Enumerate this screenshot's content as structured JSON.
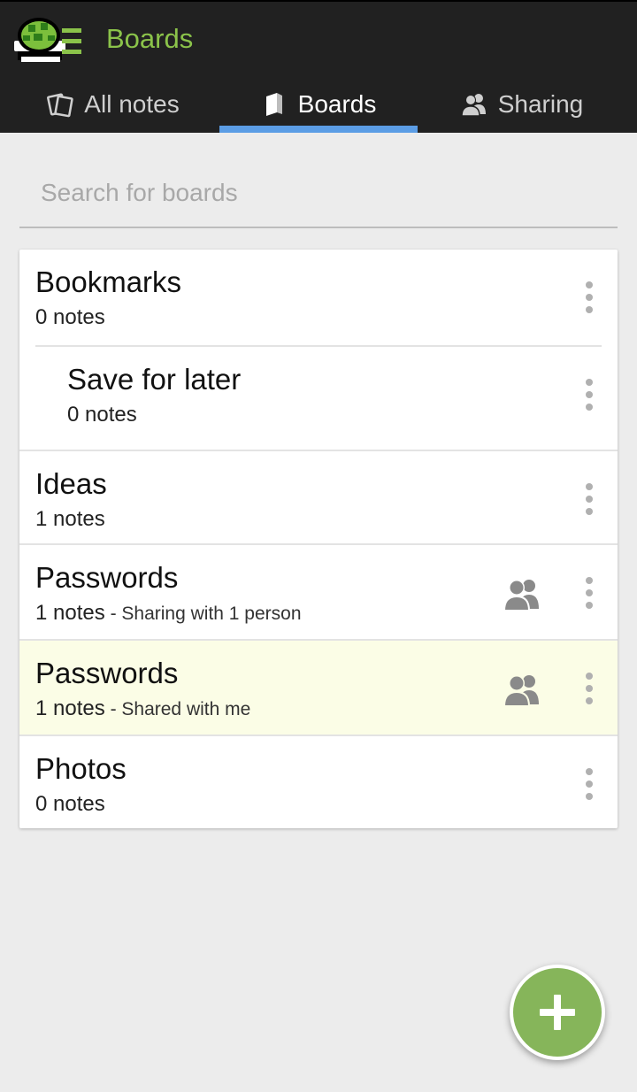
{
  "app": {
    "title": "Boards",
    "accent_color": "#8bc34a",
    "logo_icon": "turtle-shell-logo"
  },
  "tabs": [
    {
      "label": "All notes",
      "icon": "notes-icon",
      "active": false
    },
    {
      "label": "Boards",
      "icon": "board-book-icon",
      "active": true
    },
    {
      "label": "Sharing",
      "icon": "people-icon",
      "active": false
    }
  ],
  "search": {
    "placeholder": "Search for boards",
    "value": ""
  },
  "boards": [
    {
      "name": "Bookmarks",
      "count": "0 notes",
      "extra": ""
    },
    {
      "name": "Save for later",
      "count": "0 notes",
      "extra": "",
      "nested": true
    },
    {
      "name": "Ideas",
      "count": "1 notes",
      "extra": ""
    },
    {
      "name": "Passwords",
      "count": "1 notes",
      "extra": " - Sharing with 1 person",
      "shared": true
    },
    {
      "name": "Passwords",
      "count": "1 notes",
      "extra": " - Shared with me",
      "shared": true,
      "highlight": "#fbfde6"
    },
    {
      "name": "Photos",
      "count": "0 notes",
      "extra": ""
    }
  ],
  "fab": {
    "icon": "plus-icon",
    "color": "#86b55a"
  }
}
